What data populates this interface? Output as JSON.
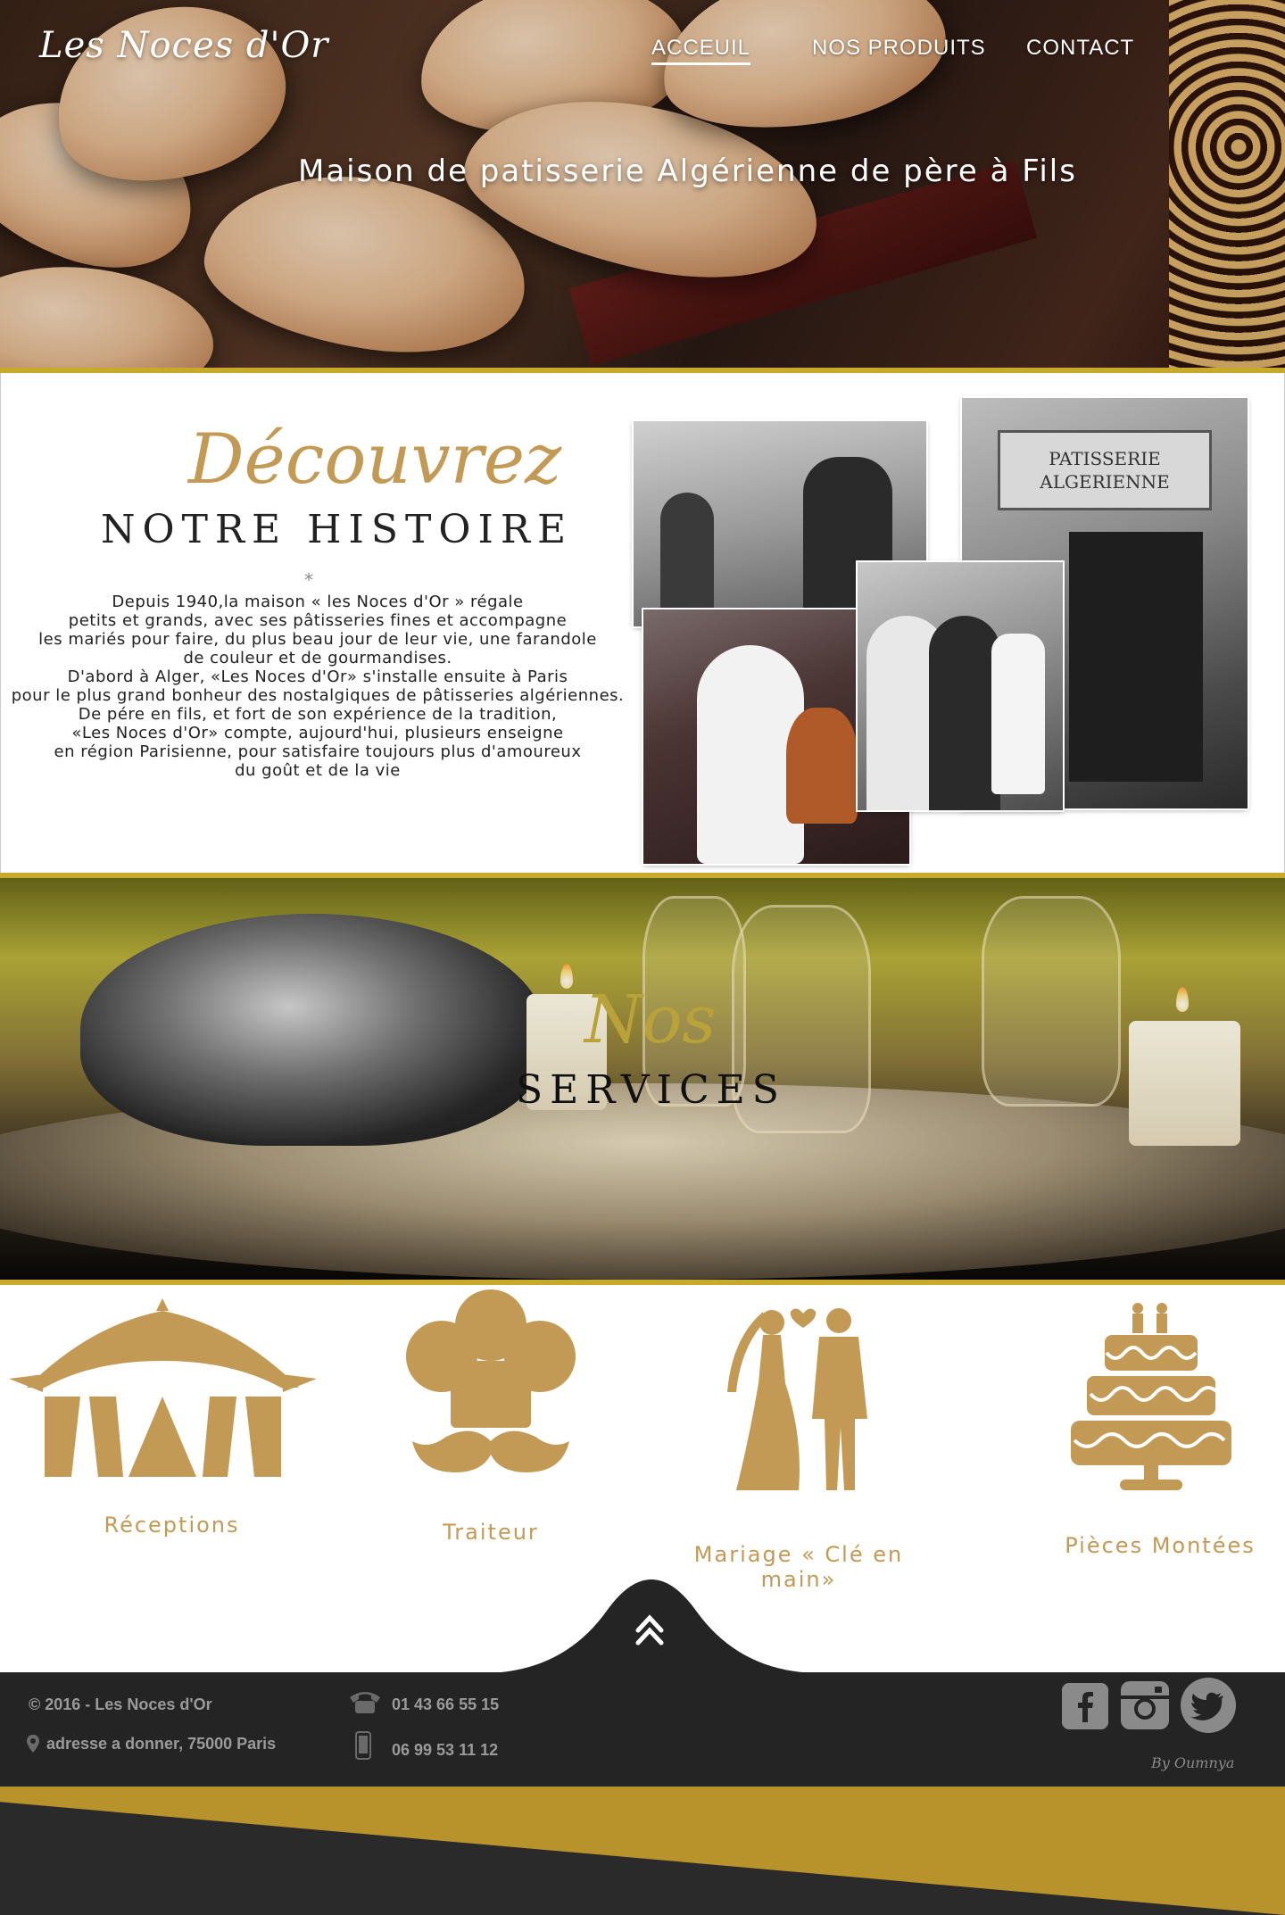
{
  "header": {
    "logo": "Les Noces d'Or",
    "nav": [
      {
        "label": "ACCEUIL",
        "active": true
      },
      {
        "label": "NOS PRODUITS",
        "active": false
      },
      {
        "label": "CONTACT",
        "active": false
      }
    ],
    "tagline": "Maison de patisserie Algérienne de père à Fils"
  },
  "history": {
    "script_title": "Découvrez",
    "title": "NOTRE HISTOIRE",
    "divider": "*",
    "lines": [
      "Depuis 1940,la maison « les Noces d'Or » régale",
      "petits et grands, avec ses pâtisseries fines et accompagne",
      "les mariés pour faire, du plus beau jour de leur vie, une farandole",
      "de couleur et de gourmandises.",
      "D'abord à Alger, «Les Noces d'Or» s'installe ensuite à Paris",
      "pour le plus grand bonheur des nostalgiques de pâtisseries algériennes.",
      "De pére en fils, et fort de son expérience de la tradition,",
      "«Les Noces d'Or» compte, aujourd'hui, plusieurs enseigne",
      "en région Parisienne, pour satisfaire toujours plus d'amoureux",
      "du goût et de la vie"
    ],
    "shop_sign": [
      "PATISSERIE",
      "ALGERIENNE"
    ]
  },
  "services": {
    "script_title": "Nos",
    "title": "SERVICES",
    "items": [
      {
        "label": "Réceptions",
        "icon": "tent-icon"
      },
      {
        "label": "Traiteur",
        "icon": "chef-hat-mustache-icon"
      },
      {
        "label": "Mariage « Clé en main»",
        "icon": "wedding-couple-icon"
      },
      {
        "label": "Pièces Montées",
        "icon": "wedding-cake-icon"
      }
    ]
  },
  "footer": {
    "copyright": "© 2016 - Les Noces d'Or",
    "address": "adresse a donner, 75000 Paris",
    "phone": "01 43 66 55 15",
    "mobile": "06 99 53 11 12",
    "credit": "By Oumnya",
    "social": [
      "facebook-icon",
      "instagram-icon",
      "twitter-icon"
    ]
  },
  "colors": {
    "gold": "#c39a55",
    "bar": "#c9a92c",
    "dark": "#242424"
  }
}
